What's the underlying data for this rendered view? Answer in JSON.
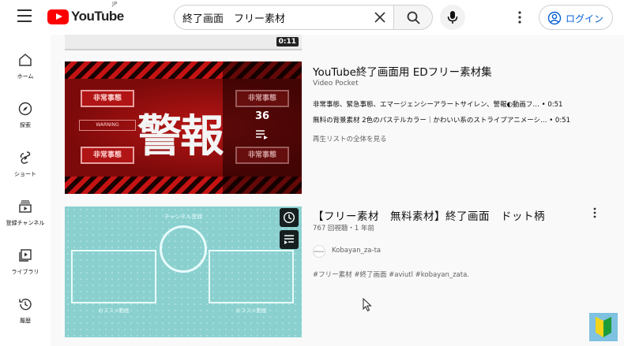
{
  "header": {
    "logo_text": "YouTube",
    "logo_region": "JP",
    "search_value": "終了画面　フリー素材",
    "login_label": "ログイン"
  },
  "sidebar": {
    "items": [
      {
        "label": "ホーム",
        "icon": "home-icon"
      },
      {
        "label": "探索",
        "icon": "compass-icon"
      },
      {
        "label": "ショート",
        "icon": "shorts-icon"
      },
      {
        "label": "登録チャンネル",
        "icon": "subscriptions-icon"
      },
      {
        "label": "ライブラリ",
        "icon": "library-icon"
      },
      {
        "label": "履歴",
        "icon": "history-icon"
      }
    ]
  },
  "prev_video": {
    "duration": "0:11"
  },
  "playlist": {
    "title": "YouTube終了画面用 EDフリー素材集",
    "channel": "Video Pocket",
    "video_count": "36",
    "thumbnail_text": "警報",
    "thumbnail_badge": "非常事態",
    "thumbnail_small": "WARNING",
    "items": [
      {
        "text": "非常事態、緊急事態、エマージェンシーアラートサイレン、警報◐動画フ… • 0:51"
      },
      {
        "text": "無料の背景素材 2色のパステルカラー｜かわいい系のストライプアニメーシ… • 0:51"
      }
    ],
    "view_all": "再生リストの全体を見る"
  },
  "video2": {
    "title": "【フリー素材　無料素材】終了画面　ドット柄",
    "meta": "767 回視聴・1 年前",
    "channel": "Kobayan_za-ta",
    "avatar_text": "Kobayan",
    "tags": "#フリー素材 #終了画面 #aviutl #kobayan_zata.",
    "thumb_title": "チャンネル登録",
    "thumb_label": "おススメ動画"
  },
  "colors": {
    "brand_red": "#ff0000",
    "link_blue": "#065fd4",
    "secondary_text": "#606060"
  }
}
